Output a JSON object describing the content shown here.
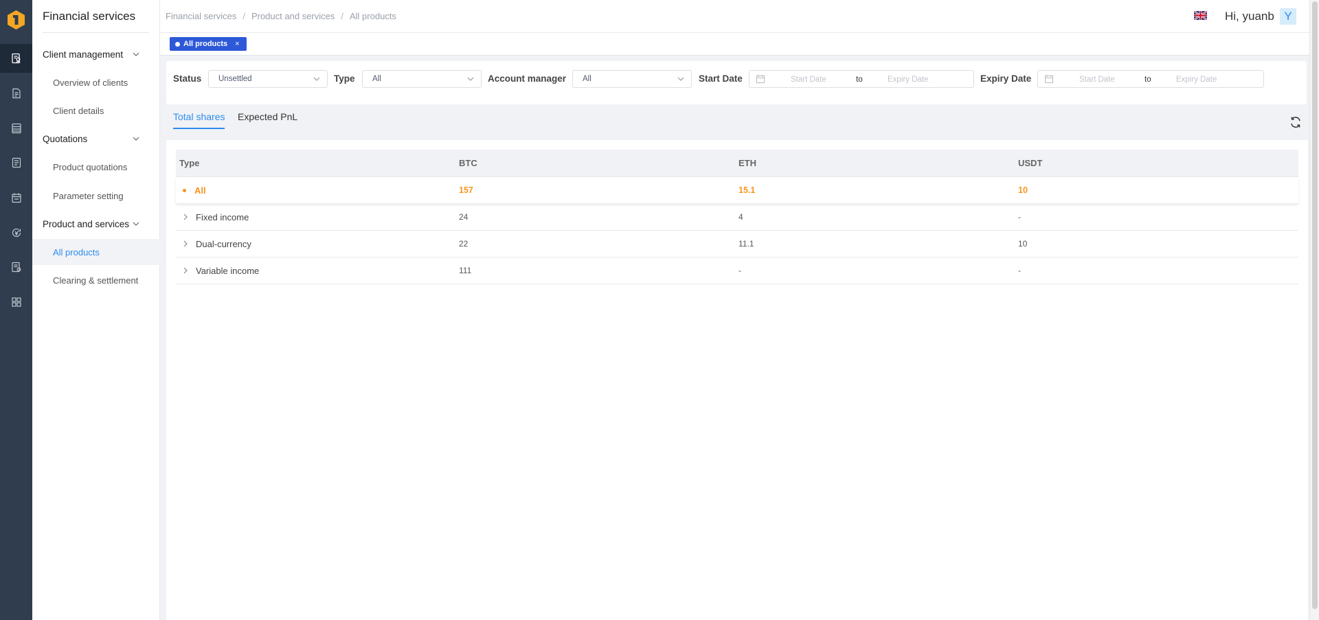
{
  "app": {
    "title": "Financial services"
  },
  "rail": {
    "icons": [
      "client-icon",
      "document-icon",
      "list-icon",
      "receipt-icon",
      "calendar-icon",
      "currency-icon",
      "report-icon",
      "grid-icon"
    ],
    "accent": "#f5a623"
  },
  "sidebar": {
    "groups": [
      {
        "label": "Client management",
        "items": [
          "Overview of clients",
          "Client details"
        ]
      },
      {
        "label": "Quotations",
        "items": [
          "Product quotations",
          "Parameter setting"
        ]
      },
      {
        "label": "Product and services",
        "items": [
          "All products",
          "Clearing & settlement"
        ]
      }
    ],
    "active_item": "All products"
  },
  "header": {
    "breadcrumb": [
      "Financial services",
      "Product and services",
      "All products"
    ],
    "breadcrumb_sep": "/",
    "greeting": "Hi, yuanb",
    "avatar_letter": "Y",
    "flag_icon": "uk-flag-icon"
  },
  "tags": [
    {
      "label": "All products",
      "close": "×"
    }
  ],
  "filters": {
    "status_label": "Status",
    "status_value": "Unsettled",
    "type_label": "Type",
    "type_value": "All",
    "manager_label": "Account manager",
    "manager_value": "All",
    "start_label": "Start Date",
    "expiry_label": "Expiry Date",
    "start_placeholder": "Start Date",
    "to_label": "to",
    "expiry_placeholder": "Expiry Date"
  },
  "tabs": {
    "active": "Total shares",
    "other": "Expected PnL"
  },
  "table": {
    "columns": [
      "Type",
      "BTC",
      "ETH",
      "USDT"
    ],
    "rows": [
      {
        "type": "All",
        "btc": "157",
        "eth": "15.1",
        "usdt": "10"
      },
      {
        "type": "Fixed income",
        "btc": "24",
        "eth": "4",
        "usdt": "-"
      },
      {
        "type": "Dual-currency",
        "btc": "22",
        "eth": "11.1",
        "usdt": "10"
      },
      {
        "type": "Variable income",
        "btc": "111",
        "eth": "-",
        "usdt": "-"
      }
    ]
  },
  "colors": {
    "primary": "#2d8cf0",
    "highlight": "#f7931e",
    "rail": "#2f3d4e",
    "tag": "#2d59d8"
  }
}
